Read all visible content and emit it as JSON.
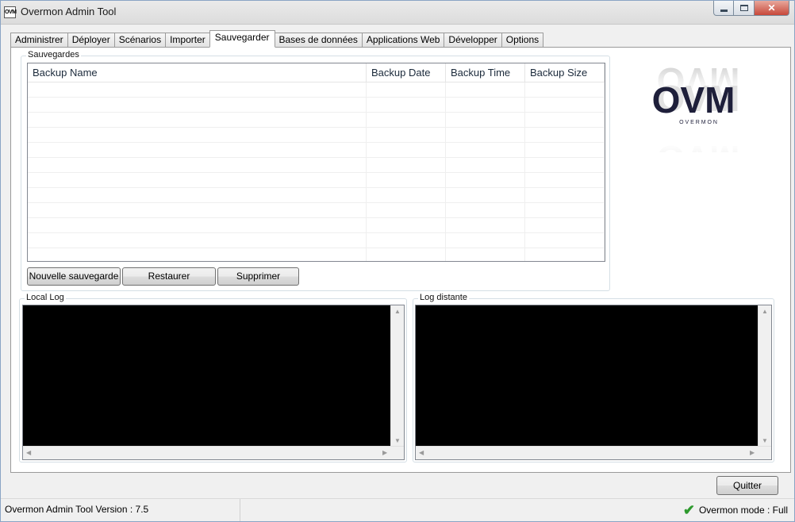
{
  "window": {
    "title": "Overmon Admin Tool",
    "icon_text": "OVM"
  },
  "tabs": [
    {
      "label": "Administrer"
    },
    {
      "label": "Déployer"
    },
    {
      "label": "Scénarios"
    },
    {
      "label": "Importer"
    },
    {
      "label": "Sauvegarder"
    },
    {
      "label": "Bases de données"
    },
    {
      "label": "Applications Web"
    },
    {
      "label": "Développer"
    },
    {
      "label": "Options"
    }
  ],
  "active_tab": "Sauvegarder",
  "backups": {
    "group_label": "Sauvegardes",
    "columns": [
      "Backup Name",
      "Backup Date",
      "Backup Time",
      "Backup Size"
    ],
    "rows": [],
    "buttons": {
      "new": "Nouvelle sauvegarde",
      "restore": "Restaurer",
      "delete": "Supprimer"
    }
  },
  "logo": {
    "text": "OVM",
    "subtitle": "O V E R M O N"
  },
  "logs": {
    "local_label": "Local Log",
    "remote_label": "Log distante"
  },
  "quit_button": "Quitter",
  "status": {
    "version": "Overmon Admin Tool Version : 7.5",
    "mode": "Overmon mode : Full",
    "mode_color": "#2e9a2e"
  }
}
